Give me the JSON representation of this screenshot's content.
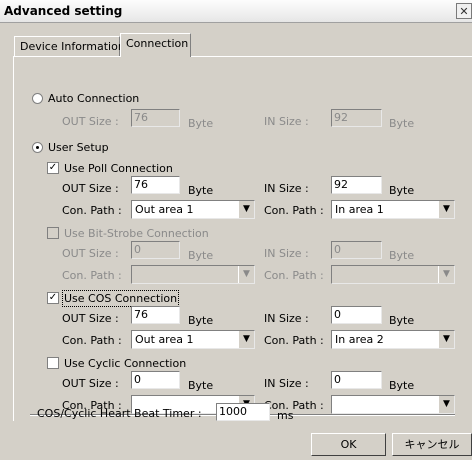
{
  "window": {
    "title": "Advanced setting",
    "close_glyph": "✕"
  },
  "tabs": [
    {
      "label": "Device Information"
    },
    {
      "label": "Connection"
    }
  ],
  "auto": {
    "label": "Auto Connection",
    "out_label": "OUT Size :",
    "out_value": "76",
    "in_label": "IN Size :",
    "in_value": "92",
    "unit": "Byte"
  },
  "user": {
    "label": "User Setup"
  },
  "poll": {
    "label": "Use Poll Connection",
    "out_label": "OUT Size :",
    "out_value": "76",
    "unit": "Byte",
    "in_label": "IN Size :",
    "in_value": "92",
    "path_label": "Con. Path :",
    "out_path": "Out area 1",
    "in_path": "In area 1"
  },
  "bitstrobe": {
    "label": "Use Bit-Strobe Connection",
    "out_label": "OUT Size :",
    "out_value": "0",
    "unit": "Byte",
    "in_label": "IN Size :",
    "in_value": "0",
    "path_label": "Con. Path :",
    "out_path": "",
    "in_path": ""
  },
  "cos": {
    "label": "Use COS Connection",
    "out_label": "OUT Size :",
    "out_value": "76",
    "unit": "Byte",
    "in_label": "IN Size :",
    "in_value": "0",
    "path_label": "Con. Path :",
    "out_path": "Out area 1",
    "in_path": "In area 2"
  },
  "cyclic": {
    "label": "Use Cyclic Connection",
    "out_label": "OUT Size :",
    "out_value": "0",
    "unit": "Byte",
    "in_label": "IN Size :",
    "in_value": "0",
    "path_label": "Con. Path :",
    "out_path": "",
    "in_path": ""
  },
  "heartbeat": {
    "label": "COS/Cyclic Heart Beat Timer :",
    "value": "1000",
    "unit": "ms"
  },
  "buttons": {
    "ok": "OK",
    "cancel": "キャンセル"
  },
  "glyphs": {
    "check": "✓",
    "dropdown": "▼"
  },
  "icons": {
    "close": "close-icon",
    "dropdown": "chevron-down-icon",
    "check": "check-icon"
  }
}
